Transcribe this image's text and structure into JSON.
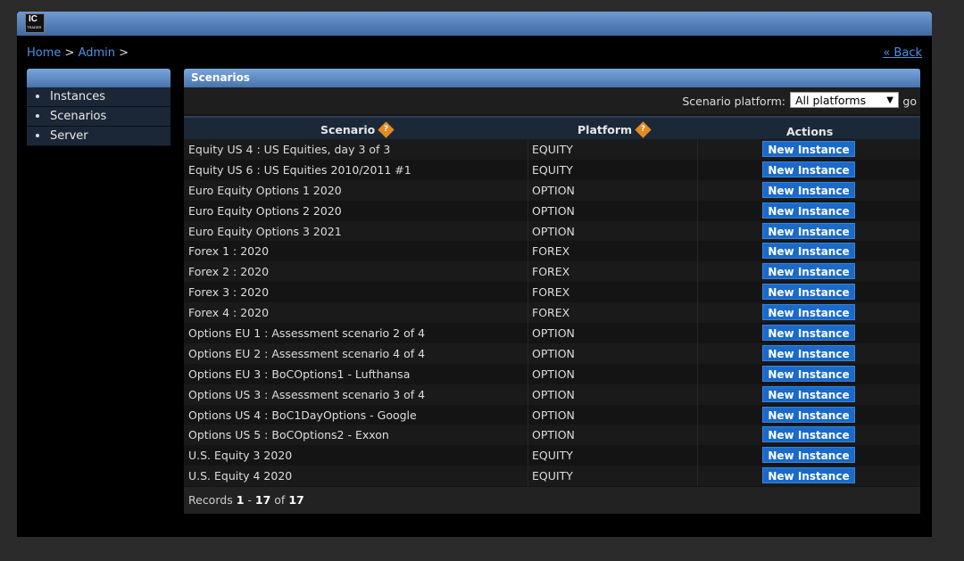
{
  "logo": {
    "line1": "IC",
    "line2": "TRADER"
  },
  "breadcrumb": {
    "home": "Home",
    "admin": "Admin",
    "sep": ">"
  },
  "back": "« Back",
  "sidebar": {
    "items": [
      {
        "label": "Instances"
      },
      {
        "label": "Scenarios"
      },
      {
        "label": "Server"
      }
    ]
  },
  "panel": {
    "title": "Scenarios"
  },
  "filter": {
    "label": "Scenario platform:",
    "selected": "All platforms",
    "go": "go"
  },
  "columns": {
    "scenario": "Scenario",
    "platform": "Platform",
    "actions": "Actions"
  },
  "help_glyph": "?",
  "button_label": "New Instance",
  "rows": [
    {
      "scenario": "Equity US 4 : US Equities, day 3 of 3",
      "platform": "EQUITY"
    },
    {
      "scenario": "Equity US 6 : US Equities 2010/2011 #1",
      "platform": "EQUITY"
    },
    {
      "scenario": "Euro Equity Options 1 2020",
      "platform": "OPTION"
    },
    {
      "scenario": "Euro Equity Options 2 2020",
      "platform": "OPTION"
    },
    {
      "scenario": "Euro Equity Options 3 2021",
      "platform": "OPTION"
    },
    {
      "scenario": "Forex 1 : 2020",
      "platform": "FOREX"
    },
    {
      "scenario": "Forex 2 : 2020",
      "platform": "FOREX"
    },
    {
      "scenario": "Forex 3 : 2020",
      "platform": "FOREX"
    },
    {
      "scenario": "Forex 4 : 2020",
      "platform": "FOREX"
    },
    {
      "scenario": "Options EU 1 : Assessment scenario 2 of 4",
      "platform": "OPTION"
    },
    {
      "scenario": "Options EU 2 : Assessment scenario 4 of 4",
      "platform": "OPTION"
    },
    {
      "scenario": "Options EU 3 : BoCOptions1 - Lufthansa",
      "platform": "OPTION"
    },
    {
      "scenario": "Options US 3 : Assessment scenario 3 of 4",
      "platform": "OPTION"
    },
    {
      "scenario": "Options US 4 : BoC1DayOptions - Google",
      "platform": "OPTION"
    },
    {
      "scenario": "Options US 5 : BoCOptions2 - Exxon",
      "platform": "OPTION"
    },
    {
      "scenario": "U.S. Equity 3 2020",
      "platform": "EQUITY"
    },
    {
      "scenario": "U.S. Equity 4 2020",
      "platform": "EQUITY"
    }
  ],
  "records": {
    "prefix": "Records",
    "from": "1",
    "dash": "-",
    "to": "17",
    "of": "of",
    "total": "17"
  }
}
